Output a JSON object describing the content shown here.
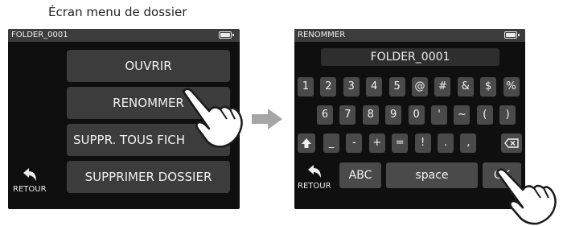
{
  "caption": "Écran menu de dossier",
  "screen1": {
    "title": "FOLDER_0001",
    "items": [
      {
        "label": "OUVRIR"
      },
      {
        "label": "RENOMMER"
      },
      {
        "label": "SUPPR. TOUS FICH"
      },
      {
        "label": "SUPPRIMER DOSSIER"
      }
    ],
    "back_label": "RETOUR"
  },
  "screen2": {
    "title": "RENOMMER",
    "name_value": "FOLDER_0001",
    "keys_row1": [
      "1",
      "2",
      "3",
      "4",
      "5",
      "@",
      "#",
      "&",
      "$",
      "%"
    ],
    "keys_row2": [
      "6",
      "7",
      "8",
      "9",
      "0",
      "'",
      "~",
      "(",
      ")"
    ],
    "keys_row3": [
      "_",
      "-",
      "+",
      "=",
      "!",
      ".",
      ","
    ],
    "shift_icon": "up-arrow-icon",
    "delete_icon": "backspace-icon",
    "abc_label": "ABC",
    "space_label": "space",
    "ok_label": "OK",
    "back_label": "RETOUR"
  },
  "colors": {
    "screen_bg": "#0f0f0f",
    "button_bg": "#3c3c3c",
    "key_bg": "#4a4a4a",
    "arrow": "#a6a6a6"
  }
}
